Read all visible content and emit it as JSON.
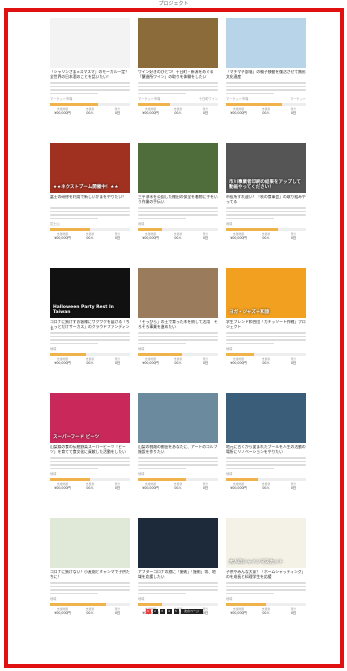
{
  "page": {
    "title": "プロジェクト",
    "accent": "#e01010",
    "progress_color": "#f0b24a"
  },
  "cards": [
    {
      "title": "「シャリンさま×スマスマ」のモーカル一定？全世界の日本酒のことを話いたい！",
      "author": "マーケット市場",
      "area": "",
      "stats": [
        {
          "l": "支援総額",
          "v": "¥00,000円"
        },
        {
          "l": "支援者",
          "v": "00人"
        },
        {
          "l": "残り",
          "v": "0日"
        }
      ],
      "progress": 0.6,
      "thumb": "spoons",
      "bg": "#f3f3f3",
      "caption": ""
    },
    {
      "title": "ワイン好きのひとつ！十日町・新潟をめぐる「醸造所ワイン」の取りを体験をしたい",
      "author": "マーケット市場",
      "area": "十日町ワイン",
      "stats": [
        {
          "l": "支援総額",
          "v": "¥00,000円"
        },
        {
          "l": "支援者",
          "v": "00人"
        },
        {
          "l": "残り",
          "v": "0日"
        }
      ],
      "progress": 0.4,
      "thumb": "wine",
      "bg": "#8b6b3a",
      "caption": ""
    },
    {
      "title": "「マチマチ部落」の親子移動を復活させて無形文化遺産",
      "author": "マーケット市場",
      "area": "マーケット",
      "stats": [
        {
          "l": "支援総額",
          "v": "¥00,000円"
        },
        {
          "l": "支援者",
          "v": "00人"
        },
        {
          "l": "残り",
          "v": "0日"
        }
      ],
      "progress": 0.7,
      "thumb": "kids",
      "bg": "#b8d4e8",
      "caption": ""
    },
    {
      "title": "富士の研修を利用で新しいかまをやりたい！",
      "author": "富士山",
      "area": "",
      "stats": [
        {
          "l": "支援総額",
          "v": "¥00,000円"
        },
        {
          "l": "支援者",
          "v": "00人"
        },
        {
          "l": "残り",
          "v": "0日"
        }
      ],
      "progress": 0.5,
      "thumb": "event",
      "bg": "#a03020",
      "caption": "★★ネクストブーム開催中！★★"
    },
    {
      "title": "三平浄水を公園した棚田の保全を着物に手をいう作業の手伝い",
      "author": "地域",
      "area": "",
      "stats": [
        {
          "l": "支援総額",
          "v": "¥00,000円"
        },
        {
          "l": "支援者",
          "v": "00人"
        },
        {
          "l": "残り",
          "v": "0日"
        }
      ],
      "progress": 0.3,
      "thumb": "field",
      "bg": "#4f6d3a",
      "caption": ""
    },
    {
      "title": "市役所すれ違い！「秋の食事会」の取り組みやってる",
      "author": "地域",
      "area": "",
      "stats": [
        {
          "l": "支援総額",
          "v": "¥00,000円"
        },
        {
          "l": "支援者",
          "v": "00人"
        },
        {
          "l": "残り",
          "v": "0日"
        }
      ],
      "progress": 0.65,
      "thumb": "tablet",
      "bg": "#555",
      "caption": "市川事業者印刷の結果をアップして動画やってください！"
    },
    {
      "title": "コロナに負けずお客様にワクワクを届ける「ちょっとだけサーカス」のクラウドファンディング",
      "author": "地域",
      "area": "",
      "stats": [
        {
          "l": "支援総額",
          "v": "¥00,000円"
        },
        {
          "l": "支援者",
          "v": "00人"
        },
        {
          "l": "残り",
          "v": "0日"
        }
      ],
      "progress": 0.45,
      "thumb": "halloween",
      "bg": "#111",
      "caption": "Halloween Party Rest In Taiwan"
    },
    {
      "title": "「そっぴら」の土で育った木を倒して活用　そろそろ事業を進めたい",
      "author": "地域",
      "area": "",
      "stats": [
        {
          "l": "支援総額",
          "v": "¥00,000円"
        },
        {
          "l": "支援者",
          "v": "00人"
        },
        {
          "l": "残り",
          "v": "0日"
        }
      ],
      "progress": 0.55,
      "thumb": "wood",
      "bg": "#9a7c5c",
      "caption": ""
    },
    {
      "title": "学生フレンド和合団「カチッソート作戦」プロジェクト",
      "author": "地域",
      "area": "",
      "stats": [
        {
          "l": "支援総額",
          "v": "¥00,000円"
        },
        {
          "l": "支援者",
          "v": "00人"
        },
        {
          "l": "残り",
          "v": "0日"
        }
      ],
      "progress": 0.35,
      "thumb": "monk",
      "bg": "#f2a020",
      "caption": "ヨガ・ジャズ＋和旅"
    },
    {
      "title": "山梨県の食の伝統野菜スーパービーツ「ビーツ」を育てて食文化に貢献した活動をしたい",
      "author": "地域",
      "area": "",
      "stats": [
        {
          "l": "支援総額",
          "v": "¥00,000円"
        },
        {
          "l": "支援者",
          "v": "00人"
        },
        {
          "l": "残り",
          "v": "0日"
        }
      ],
      "progress": 0.5,
      "thumb": "beets",
      "bg": "#c8285a",
      "caption": "スーパーフード ビーツ"
    },
    {
      "title": "山梨の桃畑の棚田をあなたに、アートのゴルフ施設を作りたい",
      "author": "地域",
      "area": "",
      "stats": [
        {
          "l": "支援総額",
          "v": "¥00,000円"
        },
        {
          "l": "支援者",
          "v": "00人"
        },
        {
          "l": "残り",
          "v": "0日"
        }
      ],
      "progress": 0.6,
      "thumb": "mountain",
      "bg": "#6b8a9e",
      "caption": ""
    },
    {
      "title": "地元に古くから愛まれたプールを人生の活動の場所にリノベーションをやりたい",
      "author": "地域",
      "area": "",
      "stats": [
        {
          "l": "支援総額",
          "v": "¥00,000円"
        },
        {
          "l": "支援者",
          "v": "00人"
        },
        {
          "l": "残り",
          "v": "0日"
        }
      ],
      "progress": 0.4,
      "thumb": "pool",
      "bg": "#3a5e7a",
      "caption": ""
    },
    {
      "title": "コロナに負けない！小麦畑とミャンマで子供たちに！",
      "author": "地域",
      "area": "",
      "stats": [
        {
          "l": "支援総額",
          "v": "¥00,000円"
        },
        {
          "l": "支援者",
          "v": "00人"
        },
        {
          "l": "残り",
          "v": "0日"
        }
      ],
      "progress": 0.7,
      "thumb": "melon",
      "bg": "#e0e8d8",
      "caption": ""
    },
    {
      "title": "アフターコロナの旅に「施術」「施術」等、地域を応援したい",
      "author": "地域",
      "area": "",
      "stats": [
        {
          "l": "支援総額",
          "v": "¥00,000円"
        },
        {
          "l": "支援者",
          "v": "00人"
        },
        {
          "l": "残り",
          "v": "0日"
        }
      ],
      "progress": 0.3,
      "thumb": "night",
      "bg": "#1c2a3a",
      "caption": ""
    },
    {
      "title": "子供やみんな大家！「ホームシャッティング」のを成長と料理学生を応援",
      "author": "地域",
      "area": "",
      "stats": [
        {
          "l": "支援総額",
          "v": "¥00,000円"
        },
        {
          "l": "支援者",
          "v": "00人"
        },
        {
          "l": "残り",
          "v": "0日"
        }
      ],
      "progress": 0.5,
      "thumb": "grapes",
      "bg": "#f4f2e6",
      "caption": "大人のシャインマスカット"
    }
  ],
  "pager": {
    "pages": [
      "1",
      "2",
      "3",
      "4",
      "5"
    ],
    "next": "次のページ"
  }
}
